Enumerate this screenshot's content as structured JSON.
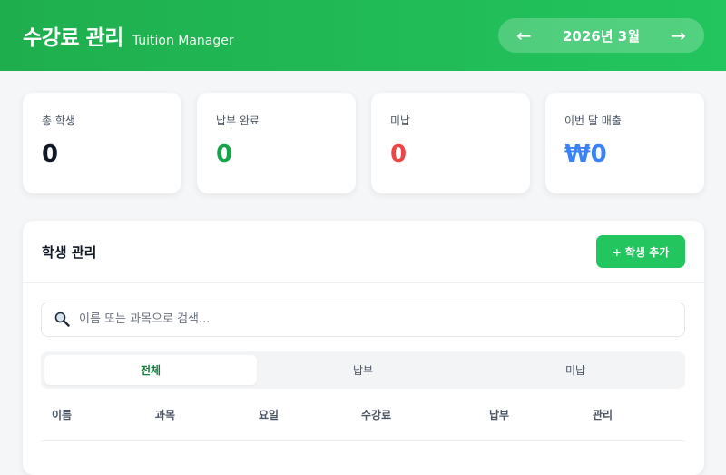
{
  "header": {
    "title": "수강료 관리",
    "subtitle": "Tuition Manager",
    "month": "2026년 3월",
    "prev_icon": "arrow-left",
    "next_icon": "arrow-right",
    "prev_glyph": "←",
    "next_glyph": "→"
  },
  "stats": [
    {
      "label": "총 학생",
      "value": "0",
      "color": "#111827"
    },
    {
      "label": "납부 완료",
      "value": "0",
      "color": "#16a34a"
    },
    {
      "label": "미납",
      "value": "0",
      "color": "#ef4444"
    },
    {
      "label": "이번 달 매출",
      "value": "₩0",
      "color": "#3b82f6"
    }
  ],
  "panel": {
    "title": "학생 관리",
    "add_button": "+ 학생 추가",
    "search_placeholder": "이름 또는 과목으로 검색...",
    "search_icon": "magnifier",
    "tabs": [
      {
        "label": "전체",
        "active": true
      },
      {
        "label": "납부",
        "active": false
      },
      {
        "label": "미납",
        "active": false
      }
    ],
    "columns": [
      "이름",
      "과목",
      "요일",
      "수강료",
      "납부",
      "관리"
    ]
  },
  "colors": {
    "accent": "#22c55e",
    "header_start": "#1fae4e",
    "background": "#f4f6f8"
  }
}
